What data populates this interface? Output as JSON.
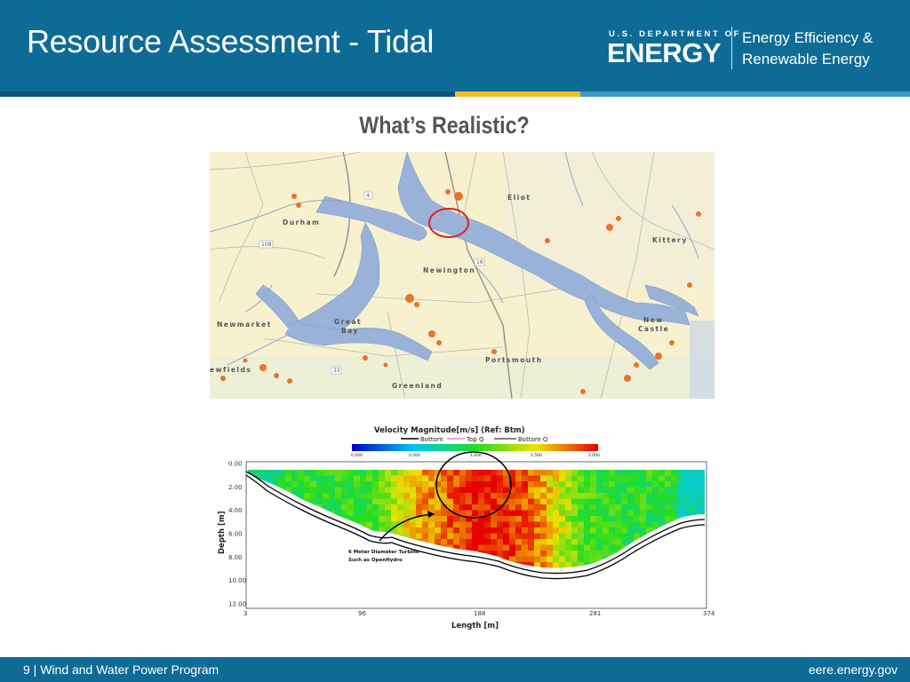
{
  "header": {
    "title": "Resource Assessment - Tidal",
    "doe_top": "U.S. DEPARTMENT OF",
    "doe_main": "ENERGY",
    "eere_line1": "Energy Efficiency &",
    "eere_line2": "Renewable Energy"
  },
  "slide": {
    "subtitle": "What’s Realistic?"
  },
  "map": {
    "labels": [
      "Eliot",
      "Durham",
      "Kittery",
      "Newington",
      "Newmarket",
      "Great",
      "Bay",
      "New",
      "Castle",
      "ewfields",
      "Portsmouth",
      "Greenland"
    ],
    "route_numbers": [
      "4",
      "108",
      "16",
      "33"
    ]
  },
  "plot": {
    "title": "Velocity Magnitude[m/s] (Ref: Btm)",
    "legend": {
      "bottom": "Bottom",
      "top_q": "Top Q",
      "bottom_q": "Bottom Q"
    },
    "colorbar_ticks": [
      "0.000",
      "0.500",
      "1.000",
      "1.500",
      "2.000"
    ],
    "y_axis_label": "Depth [m]",
    "y_ticks": [
      "0.00",
      "2.00",
      "4.00",
      "6.00",
      "8.00",
      "10.00",
      "12.00"
    ],
    "x_axis_label": "Length [m]",
    "x_ticks": [
      "3",
      "96",
      "188",
      "281",
      "374"
    ],
    "annotation_line1": "6 Meter Diameter Turbine",
    "annotation_line2": "Such as OpenHydro",
    "colors": {
      "low": "#0000c8",
      "mid": "#22dd22",
      "high": "#e60000"
    }
  },
  "footer": {
    "left": "9 | Wind and Water Power Program",
    "right": "eere.energy.gov"
  }
}
